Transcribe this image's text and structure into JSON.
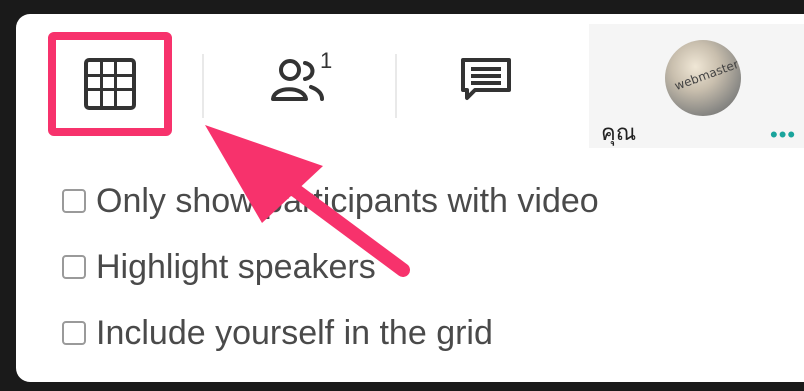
{
  "toolbar": {
    "people_count": "1",
    "self_label": "คุณ",
    "avatar_text": "webmaster",
    "more_dots": "•••"
  },
  "options": [
    {
      "label": "Only show participants with video",
      "checked": false
    },
    {
      "label": "Highlight speakers",
      "checked": false
    },
    {
      "label": "Include yourself in the grid",
      "checked": false
    }
  ],
  "colors": {
    "highlight": "#f7326c",
    "accent_dots": "#1aa49c",
    "text": "#4a4a4a"
  },
  "icons": [
    "grid-layout-icon",
    "people-icon",
    "chat-icon"
  ]
}
